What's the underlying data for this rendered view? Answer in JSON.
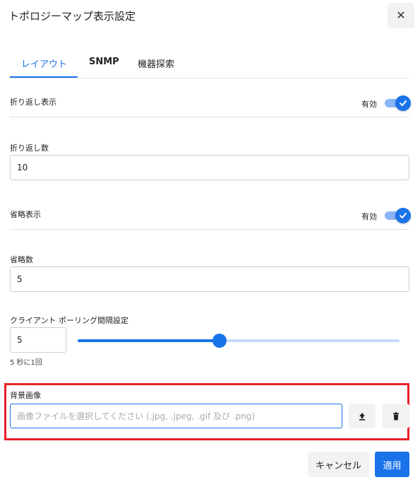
{
  "dialog": {
    "title": "トポロジーマップ表示設定",
    "close_icon": "close-icon"
  },
  "tabs": [
    {
      "label": "レイアウト",
      "active": true
    },
    {
      "label": "SNMP",
      "active": false
    },
    {
      "label": "機器探索",
      "active": false
    }
  ],
  "wrap_display": {
    "label": "折り返し表示",
    "toggle_label": "有効",
    "enabled": true
  },
  "wrap_count": {
    "label": "折り返し数",
    "value": "10"
  },
  "abbrev_display": {
    "label": "省略表示",
    "toggle_label": "有効",
    "enabled": true
  },
  "abbrev_count": {
    "label": "省略数",
    "value": "5"
  },
  "polling": {
    "label": "クライアント ポーリング間隔設定",
    "value": "5",
    "slider_fraction": 0.44,
    "hint": "5 秒に1回"
  },
  "background_image": {
    "label": "背景画像",
    "placeholder": "画像ファイルを選択してください (.jpg, .jpeg, .gif 及び .png)",
    "upload_icon": "upload-icon",
    "delete_icon": "trash-icon"
  },
  "footer": {
    "cancel_label": "キャンセル",
    "apply_label": "適用"
  },
  "colors": {
    "accent": "#1a73e8",
    "highlight_border": "#e8212a"
  }
}
